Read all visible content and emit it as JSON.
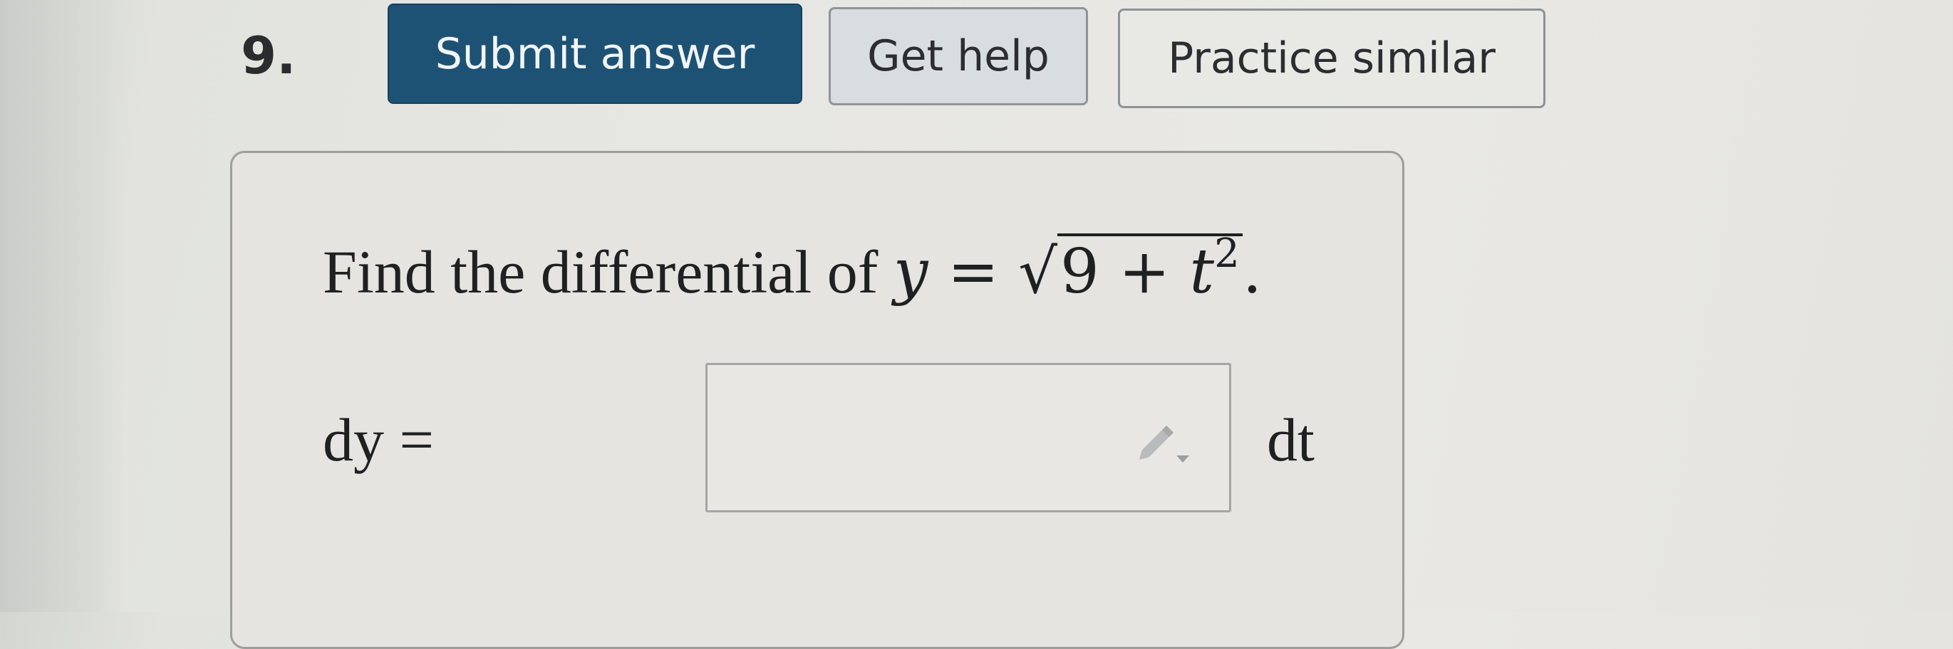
{
  "question": {
    "number": "9."
  },
  "toolbar": {
    "submit_label": "Submit answer",
    "help_label": "Get help",
    "practice_label": "Practice similar"
  },
  "prompt": {
    "text": "Find the differential of",
    "var_y": "y",
    "equals": "=",
    "sqrt_symbol": "√",
    "radicand_constant": "9",
    "plus": "+",
    "var_t": "t",
    "exponent": "2",
    "period": "."
  },
  "answer": {
    "lhs_label": "dy =",
    "input_value": "",
    "rhs_label": "dt",
    "edit_icon": "pencil-dropdown-icon"
  },
  "colors": {
    "submit_bg": "#1d5275",
    "help_bg": "#d8dde2",
    "practice_bg": "#e8e8e5"
  }
}
